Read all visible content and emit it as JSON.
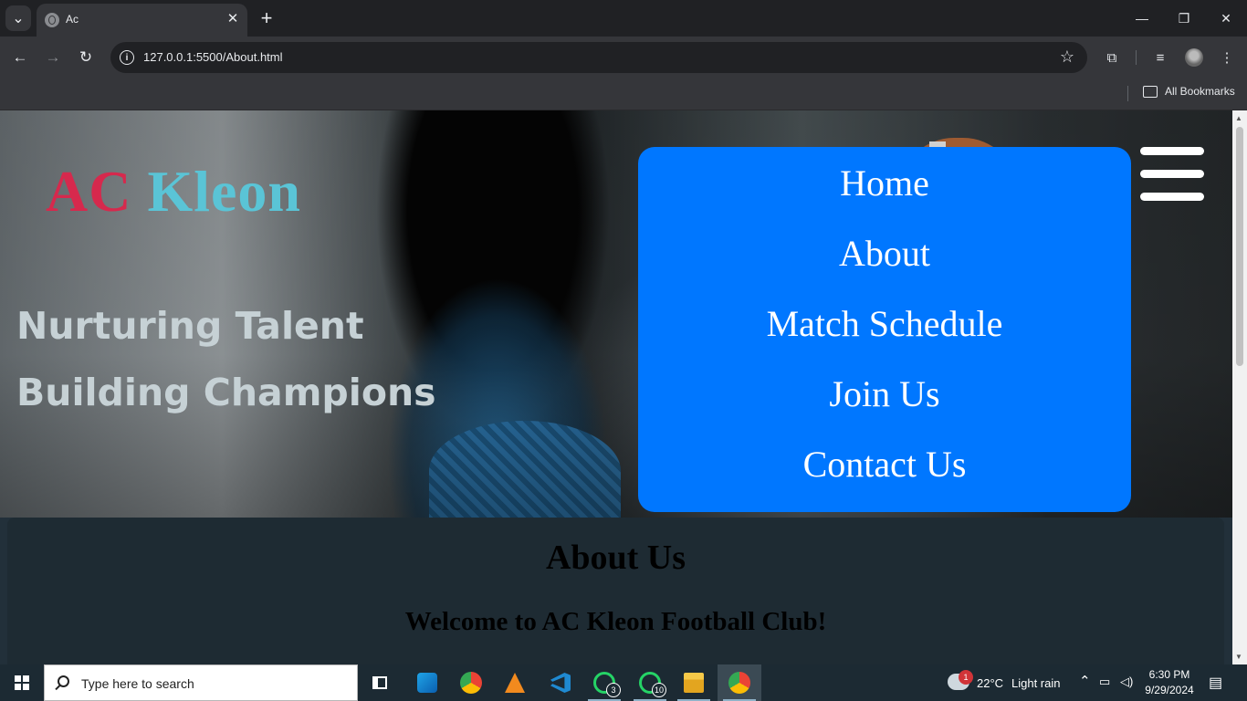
{
  "browser": {
    "tab_title": "Ac",
    "tab_close": "✕",
    "new_tab": "+",
    "window_controls": {
      "minimize": "—",
      "maximize": "❐",
      "close": "✕"
    },
    "url": "127.0.0.1:5500/About.html",
    "bookmarks_label": "All Bookmarks"
  },
  "page": {
    "logo": {
      "part1": "AC",
      "part2": "Kleon"
    },
    "tagline": {
      "line1": "Nurturing Talent",
      "line2": "Building Champions"
    },
    "menu": [
      {
        "label": "Home"
      },
      {
        "label": "About"
      },
      {
        "label": "Match Schedule"
      },
      {
        "label": "Join Us"
      },
      {
        "label": "Contact Us"
      }
    ],
    "about": {
      "title": "About Us",
      "welcome": "Welcome to AC Kleon Football Club!"
    },
    "colors": {
      "logo_ac": "#d6294d",
      "logo_kleon": "#5ac4d6",
      "menu_bg": "#0077ff",
      "tagline": "#c6d1d5"
    }
  },
  "taskbar": {
    "search_placeholder": "Type here to search",
    "apps": [
      {
        "name": "task-view-icon"
      },
      {
        "name": "snip-icon"
      },
      {
        "name": "chrome-icon"
      },
      {
        "name": "vlc-icon"
      },
      {
        "name": "vscode-icon"
      },
      {
        "name": "whatsapp-icon",
        "badge": "3"
      },
      {
        "name": "whatsapp-icon",
        "badge": "10"
      },
      {
        "name": "file-explorer-icon"
      },
      {
        "name": "chrome-active-icon"
      }
    ],
    "weather": {
      "temp": "22°C",
      "condition": "Light rain",
      "alert": "1"
    },
    "clock": {
      "time": "6:30 PM",
      "date": "9/29/2024"
    }
  }
}
